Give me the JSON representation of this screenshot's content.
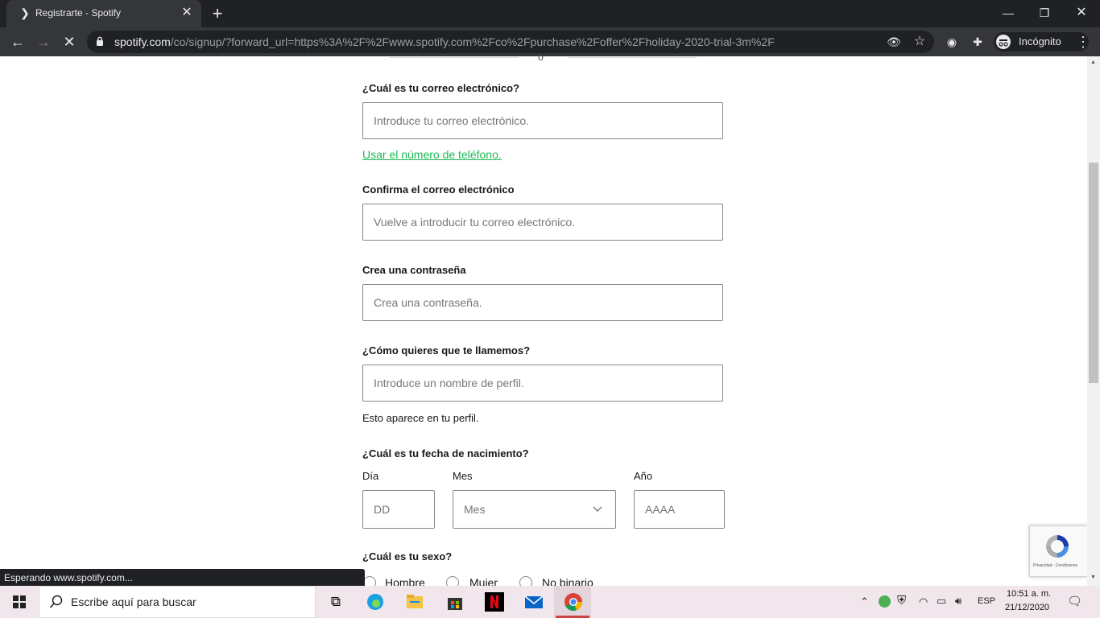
{
  "browser": {
    "tab_title": "Registrarte - Spotify",
    "url_host": "spotify.com",
    "url_path": "/co/signup/?forward_url=https%3A%2F%2Fwww.spotify.com%2Fco%2Fpurchase%2Foffer%2Fholiday-2020-trial-3m%2F",
    "profile_label": "Incógnito",
    "status_text": "Esperando www.spotify.com..."
  },
  "form": {
    "or_text": "o",
    "email_label": "¿Cuál es tu correo electrónico?",
    "email_placeholder": "Introduce tu correo electrónico.",
    "phone_link": "Usar el número de teléfono.",
    "confirm_label": "Confirma el correo electrónico",
    "confirm_placeholder": "Vuelve a introducir tu correo electrónico.",
    "password_label": "Crea una contraseña",
    "password_placeholder": "Crea una contraseña.",
    "profile_label": "¿Cómo quieres que te llamemos?",
    "profile_placeholder": "Introduce un nombre de perfil.",
    "profile_hint": "Esto aparece en tu perfil.",
    "birth_label": "¿Cuál es tu fecha de nacimiento?",
    "day_label": "Día",
    "day_placeholder": "DD",
    "month_label": "Mes",
    "month_value": "Mes",
    "year_label": "Año",
    "year_placeholder": "AAAA",
    "gender_label": "¿Cuál es tu sexo?",
    "gender_options": [
      "Hombre",
      "Mujer",
      "No binario"
    ]
  },
  "recaptcha": {
    "footer": "Privacidad - Condiciones"
  },
  "taskbar": {
    "search_placeholder": "Escribe aquí para buscar",
    "language": "ESP",
    "time": "10:51 a. m.",
    "date": "21/12/2020"
  },
  "colors": {
    "accent": "#1db954",
    "chrome_dark": "#202124",
    "chrome_toolbar": "#35363a"
  }
}
